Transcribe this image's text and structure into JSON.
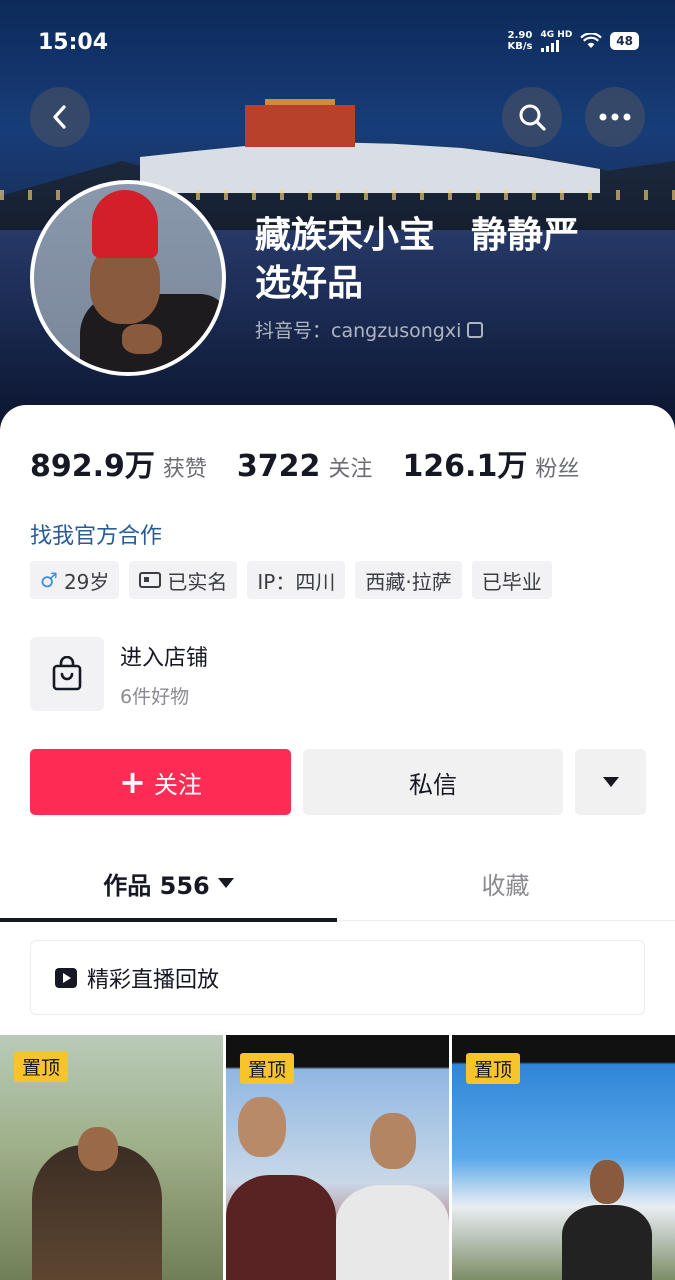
{
  "status_bar": {
    "time": "15:04",
    "net_speed_value": "2.90",
    "net_speed_unit": "KB/s",
    "net_type": "4G HD",
    "battery": "48"
  },
  "header": {
    "icons": [
      "back-icon",
      "search-icon",
      "more-icon"
    ]
  },
  "profile": {
    "name": "藏族宋小宝　静静严\n选好品",
    "douyin_id": "抖音号：cangzusongxi"
  },
  "stats": [
    {
      "value": "892.9万",
      "label": "获赞"
    },
    {
      "value": "3722",
      "label": "关注"
    },
    {
      "value": "126.1万",
      "label": "粉丝"
    }
  ],
  "business_link": "找我官方合作",
  "tags": {
    "age": "29岁",
    "verified": "已实名",
    "ip": "IP：四川",
    "location": "西藏·拉萨",
    "education": "已毕业"
  },
  "shop": {
    "title": "进入店铺",
    "subtitle": "6件好物"
  },
  "actions": {
    "follow": "关注",
    "message": "私信"
  },
  "tabs": [
    {
      "label": "作品 556"
    },
    {
      "label": "收藏"
    }
  ],
  "replay_label": "精彩直播回放",
  "videos": [
    {
      "badge": "置顶"
    },
    {
      "badge": "置顶"
    },
    {
      "badge": "置顶"
    }
  ],
  "colors": {
    "accent": "#fe2c55",
    "link": "#2a5c96",
    "pin_badge": "#f7c52b"
  }
}
